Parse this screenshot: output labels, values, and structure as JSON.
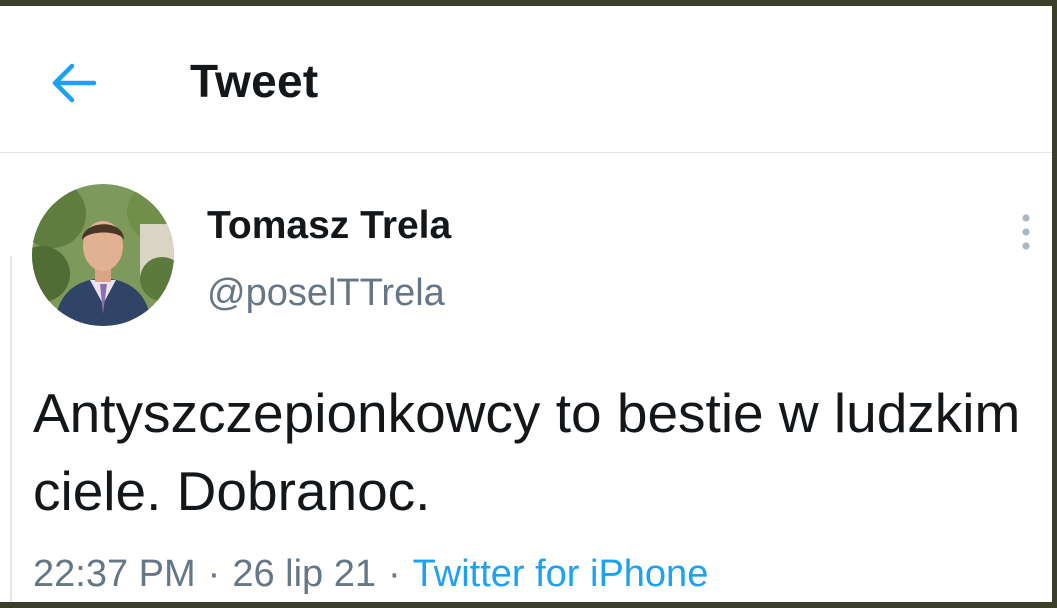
{
  "colors": {
    "accent": "#1da1f2",
    "text_primary": "#14171a",
    "text_secondary": "#657786",
    "divider": "#e3e6e8"
  },
  "header": {
    "back_icon": "arrow-left-icon",
    "title": "Tweet"
  },
  "tweet": {
    "author": {
      "name": "Tomasz Trela",
      "handle": "@poselTTrela",
      "avatar": "profile-photo"
    },
    "more_icon": "vertical-dots-icon",
    "text": "Antyszczepionkowcy to bestie w ludzkim ciele. Dobranoc.",
    "meta": {
      "time": "22:37 PM",
      "date": "26 lip 21",
      "separator": "·",
      "source": "Twitter for iPhone"
    }
  }
}
